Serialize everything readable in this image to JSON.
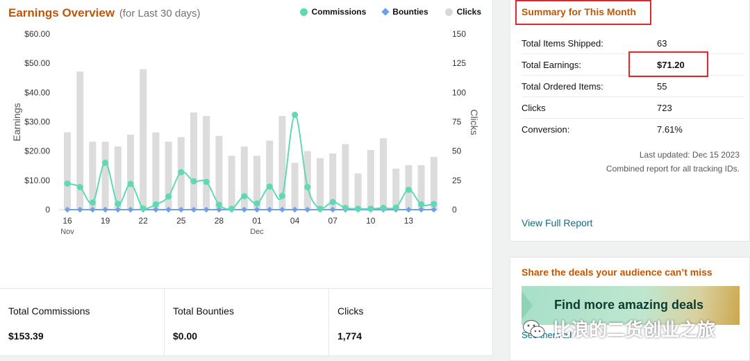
{
  "earnings": {
    "title": "Earnings Overview",
    "subtitle": "(for Last 30 days)"
  },
  "legend": [
    {
      "label": "Commissions",
      "color": "#5fd9b3",
      "shape": "dot"
    },
    {
      "label": "Bounties",
      "color": "#6f9fe8",
      "shape": "diamond"
    },
    {
      "label": "Clicks",
      "color": "#d8d8d8",
      "shape": "dot"
    }
  ],
  "chart_data": {
    "type": "bar",
    "x_tick_labels": [
      {
        "day": "16",
        "month": "Nov"
      },
      {
        "day": "19",
        "month": ""
      },
      {
        "day": "22",
        "month": ""
      },
      {
        "day": "25",
        "month": ""
      },
      {
        "day": "28",
        "month": ""
      },
      {
        "day": "01",
        "month": "Dec"
      },
      {
        "day": "04",
        "month": ""
      },
      {
        "day": "07",
        "month": ""
      },
      {
        "day": "10",
        "month": ""
      },
      {
        "day": "13",
        "month": ""
      }
    ],
    "first_date": "Nov 16",
    "last_date": "Dec 15",
    "y_left": {
      "label": "Earnings",
      "ticks": [
        "$60.00",
        "$50.00",
        "$40.00",
        "$30.00",
        "$20.00",
        "$10.00",
        "0"
      ],
      "range": [
        0,
        60
      ]
    },
    "y_right": {
      "label": "Clicks",
      "ticks": [
        "150",
        "125",
        "100",
        "75",
        "50",
        "25",
        "0"
      ],
      "range": [
        0,
        150
      ]
    },
    "series": [
      {
        "name": "Clicks",
        "axis": "right",
        "kind": "bar",
        "color": "#dcdcdc",
        "values": [
          66,
          118,
          58,
          58,
          54,
          64,
          120,
          66,
          58,
          62,
          83,
          80,
          63,
          46,
          54,
          46,
          59,
          80,
          40,
          50,
          44,
          48,
          56,
          31,
          51,
          61,
          35,
          38,
          38,
          45
        ]
      },
      {
        "name": "Commissions",
        "axis": "left",
        "kind": "line",
        "color": "#5fd9b3",
        "values": [
          8.9,
          7.7,
          2.4,
          16.0,
          2.0,
          8.8,
          0.4,
          1.8,
          4.5,
          12.8,
          9.7,
          9.5,
          1.7,
          0.3,
          4.6,
          2.1,
          7.9,
          4.7,
          32.4,
          7.7,
          0.3,
          2.6,
          0.6,
          0.3,
          0.3,
          0.6,
          0.7,
          6.8,
          1.8,
          1.9
        ]
      },
      {
        "name": "Bounties",
        "axis": "left",
        "kind": "line",
        "color": "#6f9fe8",
        "values": [
          0,
          0,
          0,
          0,
          0,
          0,
          0,
          0,
          0,
          0,
          0,
          0,
          0,
          0,
          0,
          0,
          0,
          0,
          0,
          0,
          0,
          0,
          0,
          0,
          0,
          0,
          0,
          0,
          0,
          0
        ]
      }
    ]
  },
  "totals": [
    {
      "label": "Total Commissions",
      "value": "$153.39"
    },
    {
      "label": "Total Bounties",
      "value": "$0.00"
    },
    {
      "label": "Clicks",
      "value": "1,774"
    }
  ],
  "summary": {
    "title": "Summary for This Month",
    "rows": [
      {
        "label": "Total Items Shipped:",
        "value": "63"
      },
      {
        "label": "Total Earnings:",
        "value": "$71.20"
      },
      {
        "label": "Total Ordered Items:",
        "value": "55"
      },
      {
        "label": "Clicks",
        "value": "723"
      },
      {
        "label": "Conversion:",
        "value": "7.61%"
      }
    ],
    "last_updated": "Last updated: Dec 15 2023",
    "combined_note": "Combined report for all tracking IDs.",
    "view_full_report": "View Full Report"
  },
  "deals": {
    "title": "Share the deals your audience can’t miss",
    "banner_text": "Find more amazing deals",
    "link_text": "See them all"
  },
  "watermark": {
    "text": "比浪的二货创业之旅",
    "icon": "wechat-icon"
  },
  "colors": {
    "accent_orange": "#c45500",
    "link_teal": "#007185",
    "highlight_red": "#e3242b"
  }
}
